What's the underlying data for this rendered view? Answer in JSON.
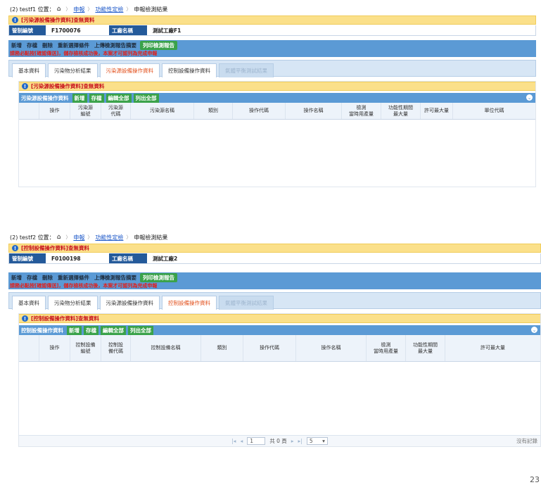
{
  "panel1": {
    "crumb": {
      "prefix": "(2) testf1 位置：",
      "link1": "申報",
      "link2": "功能性定檢",
      "current": "申報檢測結果"
    },
    "notice": "[污染源設備操作資料]查無資料",
    "id_label": "管制編號",
    "id_value": "F1700076",
    "name_label": "工廠名稱",
    "name_value": "測試工廠F1",
    "toolbar": [
      "新增",
      "存檔",
      "刪除",
      "重新選擇條件",
      "上傳檢測報告摘要"
    ],
    "toolbar_print": "列印檢測報告",
    "warning": "請務必點按[確認傳送]，儲存檢核成功後，本案才可認列為完成申報",
    "tabs": [
      "基本資料",
      "污染物分析結果",
      "污染源設備操作資料",
      "控制設備操作資料",
      "氣體平衡測試結果"
    ],
    "inner_notice": "[污染源設備操作資料]查無資料",
    "grid_title": "污染源設備操作資料",
    "grid_buttons": [
      "新增",
      "存檔",
      "編輯全部",
      "列出全部"
    ],
    "columns": [
      "操作",
      "污染源\n編號",
      "污染源\n代碼",
      "污染源名稱",
      "類別",
      "操作代碼",
      "操作名稱",
      "檢測\n當時用產量",
      "功能性期間\n最大量",
      "許可最大量",
      "單位代碼"
    ]
  },
  "panel2": {
    "crumb": {
      "prefix": "(2) testf2 位置：",
      "link1": "申報",
      "link2": "功能性定檢",
      "current": "申報檢測結果"
    },
    "notice": "[控制設備操作資料]查無資料",
    "id_label": "管制編號",
    "id_value": "F0100198",
    "name_label": "工廠名稱",
    "name_value": "測試工廠2",
    "toolbar": [
      "新增",
      "存檔",
      "刪除",
      "重新選擇條件",
      "上傳檢測報告摘要"
    ],
    "toolbar_print": "列印檢測報告",
    "warning": "請務必點按[確認傳送]，儲存檢核成功後，本案才可認列為完成申報",
    "tabs": [
      "基本資料",
      "污染物分析結果",
      "污染源設備操作資料",
      "控制設備操作資料",
      "氣體平衡測試結果"
    ],
    "inner_notice": "[控制設備操作資料]查無資料",
    "grid_title": "控制設備操作資料",
    "grid_buttons": [
      "新增",
      "存檔",
      "編輯全部",
      "列出全部"
    ],
    "columns": [
      "操作",
      "控制設備\n編號",
      "控制設\n備代碼",
      "控制設備名稱",
      "類別",
      "操作代碼",
      "操作名稱",
      "檢測\n當時用產量",
      "功能性期間\n最大量",
      "許可最大量"
    ],
    "pager": {
      "page": "1",
      "total": "共 0 頁",
      "size": "5",
      "no_records": "沒有記錄"
    }
  },
  "page_number": "23",
  "colors": {
    "blue_bar": "#5b9ad5",
    "green_btn": "#3aa24a",
    "notice_bg": "#fbe08a",
    "warning_red": "#e0201c",
    "active_tab": "#e2501c"
  }
}
